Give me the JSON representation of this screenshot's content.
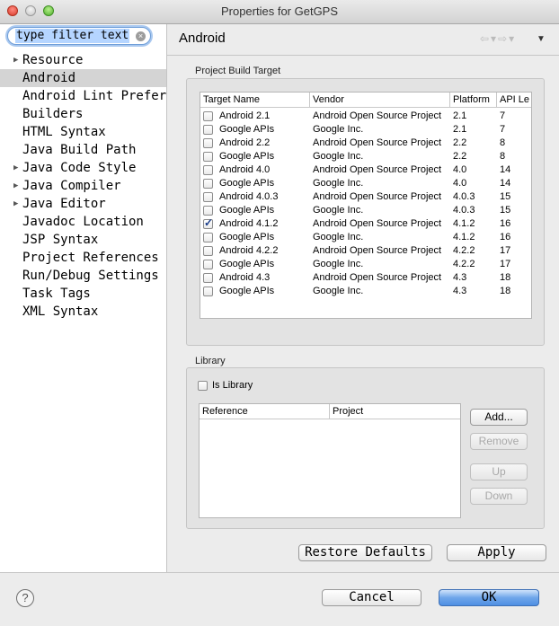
{
  "window": {
    "title": "Properties for GetGPS"
  },
  "filter": {
    "value": "type filter text"
  },
  "tree": {
    "items": [
      {
        "label": "Resource",
        "expandable": true,
        "selected": false
      },
      {
        "label": "Android",
        "expandable": false,
        "selected": true
      },
      {
        "label": "Android Lint Prefer",
        "expandable": false,
        "selected": false
      },
      {
        "label": "Builders",
        "expandable": false,
        "selected": false
      },
      {
        "label": "HTML Syntax",
        "expandable": false,
        "selected": false
      },
      {
        "label": "Java Build Path",
        "expandable": false,
        "selected": false
      },
      {
        "label": "Java Code Style",
        "expandable": true,
        "selected": false
      },
      {
        "label": "Java Compiler",
        "expandable": true,
        "selected": false
      },
      {
        "label": "Java Editor",
        "expandable": true,
        "selected": false
      },
      {
        "label": "Javadoc Location",
        "expandable": false,
        "selected": false
      },
      {
        "label": "JSP Syntax",
        "expandable": false,
        "selected": false
      },
      {
        "label": "Project References",
        "expandable": false,
        "selected": false
      },
      {
        "label": "Run/Debug Settings",
        "expandable": false,
        "selected": false
      },
      {
        "label": "Task Tags",
        "expandable": false,
        "selected": false
      },
      {
        "label": "XML Syntax",
        "expandable": false,
        "selected": false
      }
    ]
  },
  "page": {
    "title": "Android"
  },
  "build_target": {
    "label": "Project Build Target",
    "columns": [
      "Target Name",
      "Vendor",
      "Platform",
      "API Le"
    ],
    "rows": [
      {
        "name": "Android 2.1",
        "vendor": "Android Open Source Project",
        "platform": "2.1",
        "api": "7",
        "checked": false
      },
      {
        "name": "Google APIs",
        "vendor": "Google Inc.",
        "platform": "2.1",
        "api": "7",
        "checked": false
      },
      {
        "name": "Android 2.2",
        "vendor": "Android Open Source Project",
        "platform": "2.2",
        "api": "8",
        "checked": false
      },
      {
        "name": "Google APIs",
        "vendor": "Google Inc.",
        "platform": "2.2",
        "api": "8",
        "checked": false
      },
      {
        "name": "Android 4.0",
        "vendor": "Android Open Source Project",
        "platform": "4.0",
        "api": "14",
        "checked": false
      },
      {
        "name": "Google APIs",
        "vendor": "Google Inc.",
        "platform": "4.0",
        "api": "14",
        "checked": false
      },
      {
        "name": "Android 4.0.3",
        "vendor": "Android Open Source Project",
        "platform": "4.0.3",
        "api": "15",
        "checked": false
      },
      {
        "name": "Google APIs",
        "vendor": "Google Inc.",
        "platform": "4.0.3",
        "api": "15",
        "checked": false
      },
      {
        "name": "Android 4.1.2",
        "vendor": "Android Open Source Project",
        "platform": "4.1.2",
        "api": "16",
        "checked": true
      },
      {
        "name": "Google APIs",
        "vendor": "Google Inc.",
        "platform": "4.1.2",
        "api": "16",
        "checked": false
      },
      {
        "name": "Android 4.2.2",
        "vendor": "Android Open Source Project",
        "platform": "4.2.2",
        "api": "17",
        "checked": false
      },
      {
        "name": "Google APIs",
        "vendor": "Google Inc.",
        "platform": "4.2.2",
        "api": "17",
        "checked": false
      },
      {
        "name": "Android 4.3",
        "vendor": "Android Open Source Project",
        "platform": "4.3",
        "api": "18",
        "checked": false
      },
      {
        "name": "Google APIs",
        "vendor": "Google Inc.",
        "platform": "4.3",
        "api": "18",
        "checked": false
      }
    ]
  },
  "library": {
    "label": "Library",
    "is_library_label": "Is Library",
    "is_library_checked": false,
    "columns": [
      "Reference",
      "Project"
    ],
    "buttons": {
      "add": "Add...",
      "remove": "Remove",
      "up": "Up",
      "down": "Down"
    }
  },
  "actions": {
    "restore": "Restore Defaults",
    "apply": "Apply"
  },
  "footer": {
    "help": "?",
    "cancel": "Cancel",
    "ok": "OK"
  }
}
